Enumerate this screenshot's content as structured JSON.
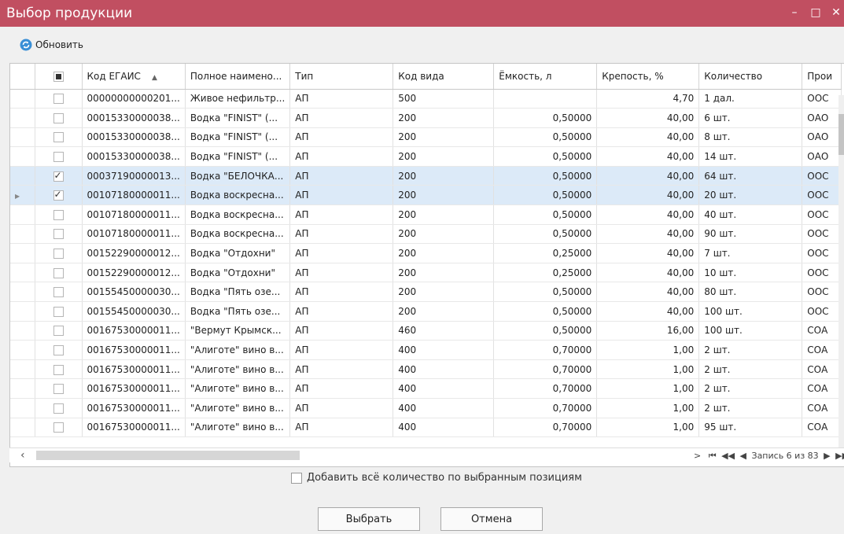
{
  "window": {
    "title": "Выбор продукции",
    "minimize": "–",
    "maximize": "□",
    "close": "✕"
  },
  "toolbar": {
    "refresh_label": "Обновить"
  },
  "columns": [
    "Код ЕГАИС",
    "Полное наимено...",
    "Тип",
    "Код вида",
    "Ёмкость, л",
    "Крепость, %",
    "Количество",
    "Прои"
  ],
  "rows": [
    {
      "code": "00000000000201...",
      "name": "Живое нефильтр...",
      "type": "АП",
      "kind": "500",
      "volume": "",
      "strength": "4,70",
      "qty": "1 дал.",
      "producer": "ООС",
      "checked": false,
      "selected": false
    },
    {
      "code": "00015330000038...",
      "name": "Водка \"FINIST\" (...",
      "type": "АП",
      "kind": "200",
      "volume": "0,50000",
      "strength": "40,00",
      "qty": "6 шт.",
      "producer": "ОАО",
      "checked": false,
      "selected": false
    },
    {
      "code": "00015330000038...",
      "name": "Водка \"FINIST\" (...",
      "type": "АП",
      "kind": "200",
      "volume": "0,50000",
      "strength": "40,00",
      "qty": "8 шт.",
      "producer": "ОАО",
      "checked": false,
      "selected": false
    },
    {
      "code": "00015330000038...",
      "name": "Водка \"FINIST\" (...",
      "type": "АП",
      "kind": "200",
      "volume": "0,50000",
      "strength": "40,00",
      "qty": "14 шт.",
      "producer": "ОАО",
      "checked": false,
      "selected": false
    },
    {
      "code": "00037190000013...",
      "name": "Водка \"БЕЛОЧКА...",
      "type": "АП",
      "kind": "200",
      "volume": "0,50000",
      "strength": "40,00",
      "qty": "64 шт.",
      "producer": "ООС",
      "checked": true,
      "selected": true
    },
    {
      "code": "00107180000011...",
      "name": "Водка воскресна...",
      "type": "АП",
      "kind": "200",
      "volume": "0,50000",
      "strength": "40,00",
      "qty": "20 шт.",
      "producer": "ООС",
      "checked": true,
      "selected": true,
      "current": true
    },
    {
      "code": "00107180000011...",
      "name": "Водка воскресна...",
      "type": "АП",
      "kind": "200",
      "volume": "0,50000",
      "strength": "40,00",
      "qty": "40 шт.",
      "producer": "ООС",
      "checked": false,
      "selected": false
    },
    {
      "code": "00107180000011...",
      "name": "Водка воскресна...",
      "type": "АП",
      "kind": "200",
      "volume": "0,50000",
      "strength": "40,00",
      "qty": "90 шт.",
      "producer": "ООС",
      "checked": false,
      "selected": false
    },
    {
      "code": "00152290000012...",
      "name": "Водка \"Отдохни\"",
      "type": "АП",
      "kind": "200",
      "volume": "0,25000",
      "strength": "40,00",
      "qty": "7 шт.",
      "producer": "ООС",
      "checked": false,
      "selected": false
    },
    {
      "code": "00152290000012...",
      "name": "Водка \"Отдохни\"",
      "type": "АП",
      "kind": "200",
      "volume": "0,25000",
      "strength": "40,00",
      "qty": "10 шт.",
      "producer": "ООС",
      "checked": false,
      "selected": false
    },
    {
      "code": "00155450000030...",
      "name": "Водка \"Пять озе...",
      "type": "АП",
      "kind": "200",
      "volume": "0,50000",
      "strength": "40,00",
      "qty": "80 шт.",
      "producer": "ООС",
      "checked": false,
      "selected": false
    },
    {
      "code": "00155450000030...",
      "name": "Водка \"Пять озе...",
      "type": "АП",
      "kind": "200",
      "volume": "0,50000",
      "strength": "40,00",
      "qty": "100 шт.",
      "producer": "ООС",
      "checked": false,
      "selected": false
    },
    {
      "code": "00167530000011...",
      "name": "\"Вермут Крымск...",
      "type": "АП",
      "kind": "460",
      "volume": "0,50000",
      "strength": "16,00",
      "qty": "100 шт.",
      "producer": "СОА",
      "checked": false,
      "selected": false
    },
    {
      "code": "00167530000011...",
      "name": "\"Алиготе\" вино в...",
      "type": "АП",
      "kind": "400",
      "volume": "0,70000",
      "strength": "1,00",
      "qty": "2 шт.",
      "producer": "СОА",
      "checked": false,
      "selected": false
    },
    {
      "code": "00167530000011...",
      "name": "\"Алиготе\" вино в...",
      "type": "АП",
      "kind": "400",
      "volume": "0,70000",
      "strength": "1,00",
      "qty": "2 шт.",
      "producer": "СОА",
      "checked": false,
      "selected": false
    },
    {
      "code": "00167530000011...",
      "name": "\"Алиготе\" вино в...",
      "type": "АП",
      "kind": "400",
      "volume": "0,70000",
      "strength": "1,00",
      "qty": "2 шт.",
      "producer": "СОА",
      "checked": false,
      "selected": false
    },
    {
      "code": "00167530000011...",
      "name": "\"Алиготе\" вино в...",
      "type": "АП",
      "kind": "400",
      "volume": "0,70000",
      "strength": "1,00",
      "qty": "2 шт.",
      "producer": "СОА",
      "checked": false,
      "selected": false
    },
    {
      "code": "00167530000011...",
      "name": "\"Алиготе\" вино в...",
      "type": "АП",
      "kind": "400",
      "volume": "0,70000",
      "strength": "1,00",
      "qty": "95 шт.",
      "producer": "СОА",
      "checked": false,
      "selected": false
    }
  ],
  "pager": {
    "first": "⏮",
    "prev_page": "◀◀",
    "prev": "◀",
    "text": "Запись 6 из 83",
    "next": "▶",
    "next_page": "▶▶",
    "last": "⏭",
    "scroll_left": "‹",
    "scroll_right": ">"
  },
  "add_all_label": "Добавить всё количество по выбранным позициям",
  "buttons": {
    "select": "Выбрать",
    "cancel": "Отмена"
  }
}
